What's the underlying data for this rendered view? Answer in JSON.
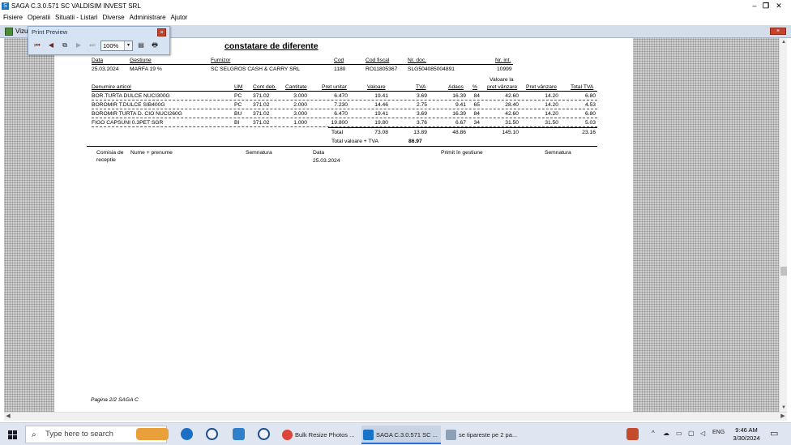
{
  "window": {
    "title": "SAGA C.3.0.571 SC VALDISIM INVEST SRL",
    "minimize": "–",
    "restore": "❐",
    "close": "✕"
  },
  "menu": [
    "Fisiere",
    "Operatii",
    "Situatii - Listari",
    "Diverse",
    "Administrare",
    "Ajutor"
  ],
  "doc_window": {
    "label": "Vizu",
    "close": "×"
  },
  "print_preview": {
    "title": "Print Preview",
    "close": "×",
    "zoom": "100%",
    "zoom_arrow": "▾",
    "first": "⏮",
    "prev": "◀",
    "pages": "⧉",
    "next": "▶",
    "last": "⏭",
    "export": "▤",
    "print": "🖶"
  },
  "document": {
    "title": "constatare de diferente",
    "h1": {
      "data": "Data",
      "gestiune": "Gestiune",
      "furnizor": "Furnizor",
      "cod": "Cod",
      "cod_fiscal": "Cod fiscal",
      "nr_doc": "Nr. doc.",
      "nr_int": "Nr. int."
    },
    "v1": {
      "data": "25.03.2024",
      "gestiune": "MARFA 19 %",
      "furnizor": "SC SELGROS CASH & CARRY SRL",
      "cod": "1180",
      "cod_fiscal": "RO11805367",
      "nr_doc": "SLG504085004891",
      "nr_int": "10999"
    },
    "h2": {
      "denumire": "Denumire articol",
      "um": "UM",
      "cont": "Cont deb.",
      "cantitate": "Cantitate",
      "pret_unitar": "Pret unitar",
      "valoare": "Valoare",
      "tva": "TVA",
      "adaos": "Adaos",
      "pct": "%",
      "val_pret_1": "Valoare la",
      "val_pret_2": "pret vânzare",
      "pret_vanzare": "Pret vânzare",
      "total_tva": "Total TVA"
    },
    "rows": [
      {
        "den": "BOR.TURTA DULCE NUCI300G",
        "um": "PC",
        "cont": "371.02",
        "cant": "3.000",
        "pu": "6.470",
        "val": "19.41",
        "tva": "3.69",
        "adaos": "16.39",
        "pct": "84",
        "vpv": "42.60",
        "pv": "14.20",
        "ttva": "6.80"
      },
      {
        "den": "BOROMIR T.DULCE SIB400G",
        "um": "PC",
        "cont": "371.02",
        "cant": "2.000",
        "pu": "7.230",
        "val": "14.46",
        "tva": "2.75",
        "adaos": "9.41",
        "pct": "65",
        "vpv": "28.40",
        "pv": "14.20",
        "ttva": "4.53"
      },
      {
        "den": "BOROMIR TURTA D. CIO NUCI260G",
        "um": "BU",
        "cont": "371.02",
        "cant": "3.000",
        "pu": "6.470",
        "val": "19.41",
        "tva": "3.69",
        "adaos": "16.39",
        "pct": "84",
        "vpv": "42.60",
        "pv": "14.20",
        "ttva": "6.80"
      },
      {
        "den": "FIGO CAPSUNI 0.3PET SGR",
        "um": "BI",
        "cont": "371.02",
        "cant": "1.000",
        "pu": "19.800",
        "val": "19.80",
        "tva": "3.76",
        "adaos": "6.67",
        "pct": "34",
        "vpv": "31.50",
        "pv": "31.50",
        "ttva": "5.03"
      }
    ],
    "totals": {
      "label": "Total",
      "val": "73.08",
      "tva": "13.89",
      "adaos": "48.86",
      "vpv": "145.10",
      "ttva": "23.16",
      "label2": "Total valoare + TVA",
      "total": "86.97"
    },
    "footer": {
      "comisia1": "Comisia de",
      "comisia2": "receptie",
      "nume": "Nume + prenume",
      "semnatura": "Semnatura",
      "data_lbl": "Data",
      "data_val": "25.03.2024",
      "primit": "Primit în gestiune",
      "semnatura2": "Semnatura"
    },
    "page_footer": "Pagina 2/2  SAGA C"
  },
  "taskbar": {
    "search_placeholder": "Type here to search",
    "apps": [
      {
        "label": "Bulk Resize Photos ..."
      },
      {
        "label": "SAGA C.3.0.571 SC ..."
      },
      {
        "label": "se tipareste pe 2 pa..."
      }
    ],
    "lang": "ENG",
    "time": "9:46 AM",
    "date": "3/30/2024"
  }
}
